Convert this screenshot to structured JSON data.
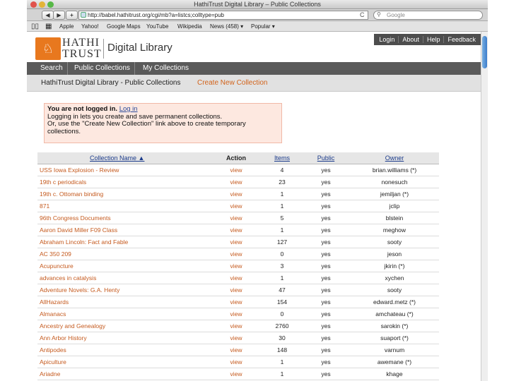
{
  "window": {
    "title": "HathiTrust Digital Library – Public Collections"
  },
  "toolbar": {
    "back": "◀",
    "forward": "▶",
    "add": "+",
    "url": "http://babel.hathitrust.org/cgi/mb?a=listcs;colltype=pub",
    "reload": "C",
    "search_placeholder": "Google"
  },
  "bookmarks": [
    "Apple",
    "Yahoo!",
    "Google Maps",
    "YouTube",
    "Wikipedia",
    "News (458) ▾",
    "Popular ▾"
  ],
  "toplinks": [
    "Login",
    "About",
    "Help",
    "Feedback"
  ],
  "brand": {
    "line1": "HATHI",
    "line2": "TRUST",
    "name": "Digital Library"
  },
  "nav": {
    "items": [
      "Search",
      "Public Collections",
      "My Collections"
    ]
  },
  "subnav": {
    "breadcrumb": "HathiTrust Digital Library - Public Collections",
    "create": "Create New Collection"
  },
  "notice": {
    "not_logged": "You are not logged in.",
    "login_link": "Log in",
    "line2": "Logging in lets you create and save permanent collections.",
    "line3": "Or, use the \"Create New Collection\" link above to create temporary collections."
  },
  "table": {
    "headers": {
      "name": "Collection Name ▲",
      "action": "Action",
      "items": "Items",
      "public": "Public",
      "owner": "Owner"
    },
    "rows": [
      {
        "name": "USS Iowa Explosion - Review",
        "action": "view",
        "items": "4",
        "public": "yes",
        "owner": "brian.williams (*)"
      },
      {
        "name": "19th c periodicals",
        "action": "view",
        "items": "23",
        "public": "yes",
        "owner": "nonesuch"
      },
      {
        "name": "19th c. Ottoman binding",
        "action": "view",
        "items": "1",
        "public": "yes",
        "owner": "jemiljan (*)"
      },
      {
        "name": "871",
        "action": "view",
        "items": "1",
        "public": "yes",
        "owner": "jclip"
      },
      {
        "name": "96th Congress Documents",
        "action": "view",
        "items": "5",
        "public": "yes",
        "owner": "blstein"
      },
      {
        "name": "Aaron David Miller F09 Class",
        "action": "view",
        "items": "1",
        "public": "yes",
        "owner": "meghow"
      },
      {
        "name": "Abraham Lincoln: Fact and Fable",
        "action": "view",
        "items": "127",
        "public": "yes",
        "owner": "sooty"
      },
      {
        "name": "AC 350 209",
        "action": "view",
        "items": "0",
        "public": "yes",
        "owner": "jeson"
      },
      {
        "name": "Acupuncture",
        "action": "view",
        "items": "3",
        "public": "yes",
        "owner": "jkirin (*)"
      },
      {
        "name": "advances in catalysis",
        "action": "view",
        "items": "1",
        "public": "yes",
        "owner": "xychen"
      },
      {
        "name": "Adventure Novels: G.A. Henty",
        "action": "view",
        "items": "47",
        "public": "yes",
        "owner": "sooty"
      },
      {
        "name": "AllHazards",
        "action": "view",
        "items": "154",
        "public": "yes",
        "owner": "edward.metz (*)"
      },
      {
        "name": "Almanacs",
        "action": "view",
        "items": "0",
        "public": "yes",
        "owner": "amchateau (*)"
      },
      {
        "name": "Ancestry and Genealogy",
        "action": "view",
        "items": "2760",
        "public": "yes",
        "owner": "sarokin (*)"
      },
      {
        "name": "Ann Arbor History",
        "action": "view",
        "items": "30",
        "public": "yes",
        "owner": "suaport (*)"
      },
      {
        "name": "Antipodes",
        "action": "view",
        "items": "148",
        "public": "yes",
        "owner": "varnum"
      },
      {
        "name": "Apiculture",
        "action": "view",
        "items": "1",
        "public": "yes",
        "owner": "awemane (*)"
      },
      {
        "name": "Ariadne",
        "action": "view",
        "items": "1",
        "public": "yes",
        "owner": "khage"
      }
    ]
  }
}
